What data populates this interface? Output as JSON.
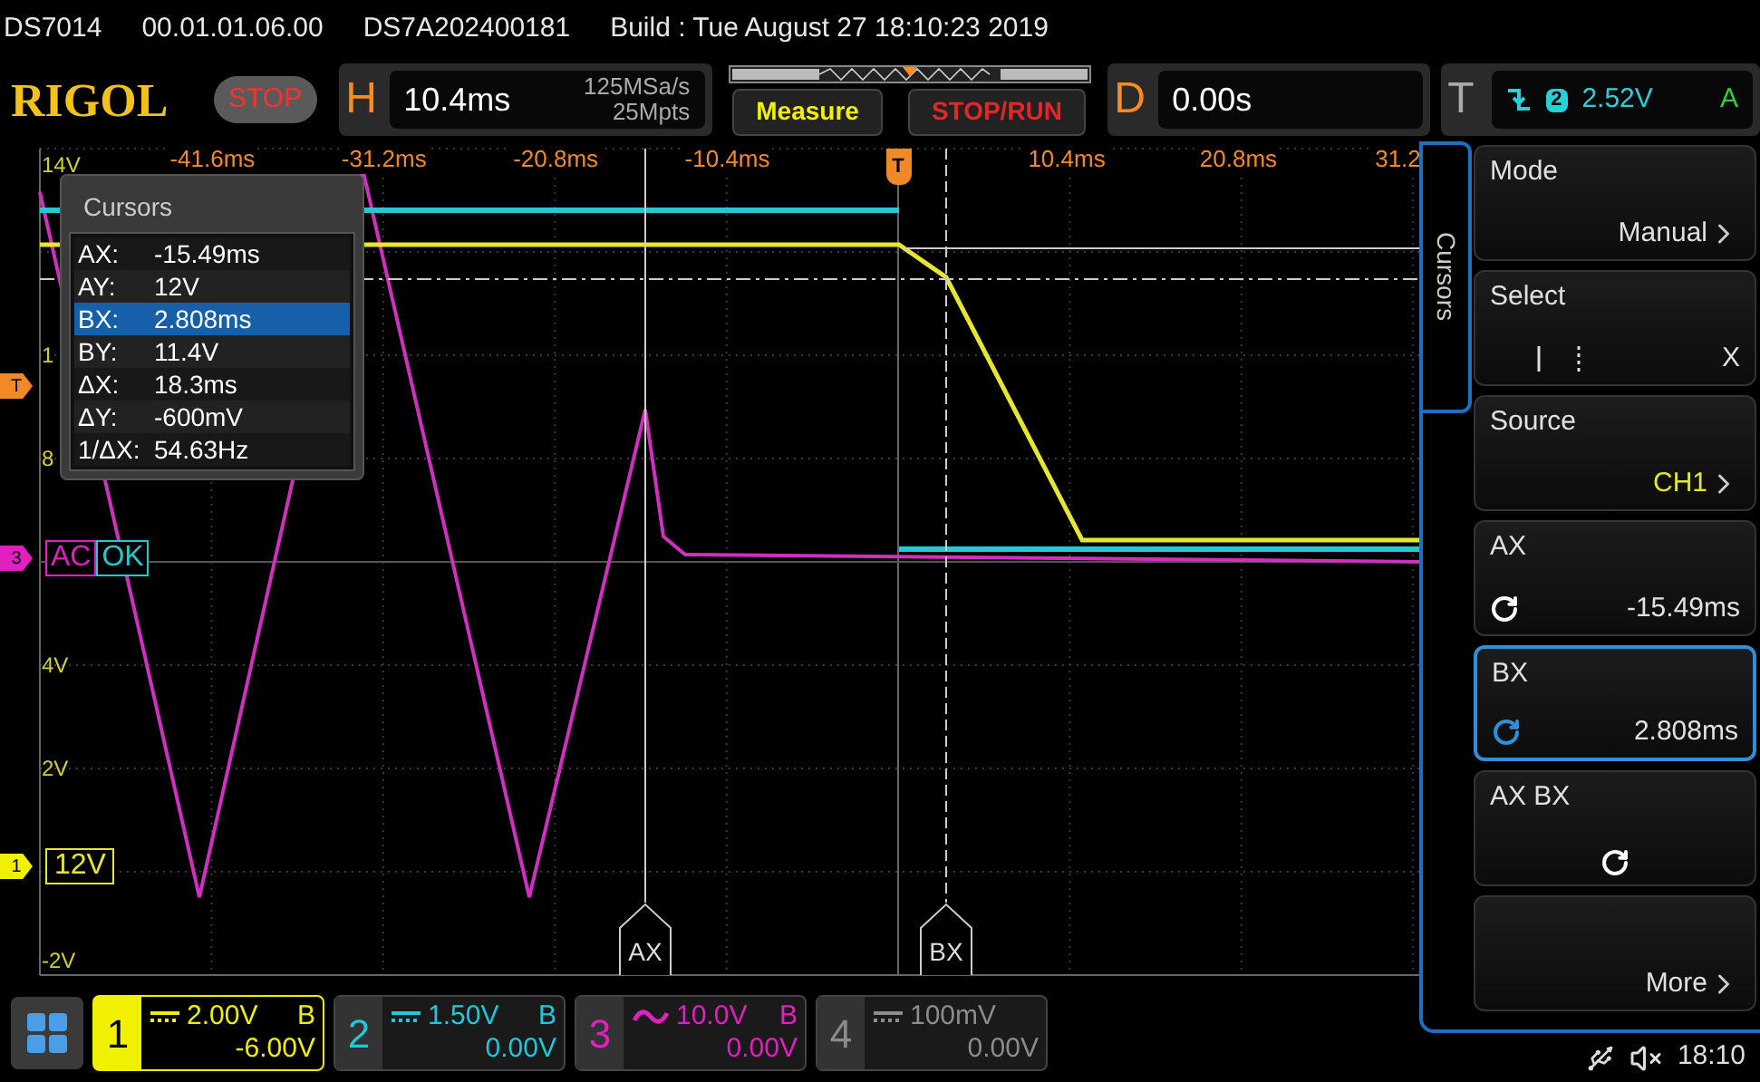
{
  "header": {
    "model": "DS7014",
    "firmware": "00.01.01.06.00",
    "serial": "DS7A202400181",
    "build": "Build : Tue August 27 18:10:23 2019"
  },
  "toolbar": {
    "logo": "RIGOL",
    "run_state": "STOP",
    "horizontal": {
      "label": "H",
      "timebase": "10.4ms",
      "sample_rate": "125MSa/s",
      "memory_depth": "25Mpts"
    },
    "buttons": [
      {
        "label": "Measure",
        "kind": "measure"
      },
      {
        "label": "STOP/RUN",
        "kind": "run_control"
      }
    ],
    "delay": {
      "label": "D",
      "value": "0.00s"
    },
    "trigger": {
      "label": "T",
      "source": "2",
      "level": "2.52V",
      "mode": "A"
    }
  },
  "waveform": {
    "time_labels": [
      "-41.6ms",
      "-31.2ms",
      "-20.8ms",
      "-10.4ms",
      "10.4ms",
      "20.8ms",
      "31.2"
    ],
    "voltage_labels": [
      "14V",
      "1",
      "8",
      "4V",
      "2V",
      "-2V"
    ],
    "trigger_marker": "T",
    "trigger_level_marker": "T",
    "channel_markers": [
      {
        "label": "3",
        "color": "#e020c0"
      },
      {
        "label": "1",
        "color": "#f0f000"
      }
    ],
    "status_tags": [
      {
        "label": "AC",
        "color": "#e020c0"
      },
      {
        "label": "OK",
        "color": "#20c8d0"
      }
    ],
    "scale_tag": "12V",
    "cursor_labels": [
      "AX",
      "BX"
    ]
  },
  "cursor_panel": {
    "title": "Cursors",
    "rows": [
      {
        "name": "AX:",
        "value": "-15.49ms",
        "selected": false
      },
      {
        "name": "AY:",
        "value": "12V",
        "selected": false
      },
      {
        "name": "BX:",
        "value": "2.808ms",
        "selected": true
      },
      {
        "name": "BY:",
        "value": "11.4V",
        "selected": false
      },
      {
        "name": "ΔX:",
        "value": "18.3ms",
        "selected": false
      },
      {
        "name": "ΔY:",
        "value": "-600mV",
        "selected": false
      },
      {
        "name": "1/ΔX:",
        "value": "54.63Hz",
        "selected": false
      }
    ]
  },
  "menu": {
    "tab": "Cursors",
    "items": [
      {
        "kind": "submenu",
        "label": "Mode",
        "value": "Manual",
        "selected": false
      },
      {
        "kind": "select",
        "label": "Select",
        "value": "X",
        "selected": false
      },
      {
        "kind": "submenu",
        "label": "Source",
        "value": "CH1",
        "color": "#e6e62e",
        "selected": false
      },
      {
        "kind": "knob",
        "label": "AX",
        "value": "-15.49ms",
        "selected": false
      },
      {
        "kind": "knob",
        "label": "BX",
        "value": "2.808ms",
        "selected": true
      },
      {
        "kind": "knob",
        "label": "AX BX",
        "selected": false
      },
      {
        "kind": "submenu",
        "value": "More",
        "selected": false
      }
    ]
  },
  "channels": [
    {
      "number": "1",
      "color": "#f0f000",
      "kind": "dc",
      "scale": "2.00V",
      "bw_limit": "B",
      "offset": "-6.00V",
      "selected": true
    },
    {
      "number": "2",
      "color": "#20c8d8",
      "kind": "dc",
      "scale": "1.50V",
      "bw_limit": "B",
      "offset": "0.00V",
      "selected": false
    },
    {
      "number": "3",
      "color": "#e020c0",
      "kind": "ac",
      "scale": "10.0V",
      "bw_limit": "B",
      "offset": "0.00V",
      "selected": false
    },
    {
      "number": "4",
      "color": "#8c8c8c",
      "kind": "dc",
      "scale": "100mV",
      "offset": "0.00V",
      "selected": false
    }
  ],
  "status": {
    "time": "18:10"
  }
}
